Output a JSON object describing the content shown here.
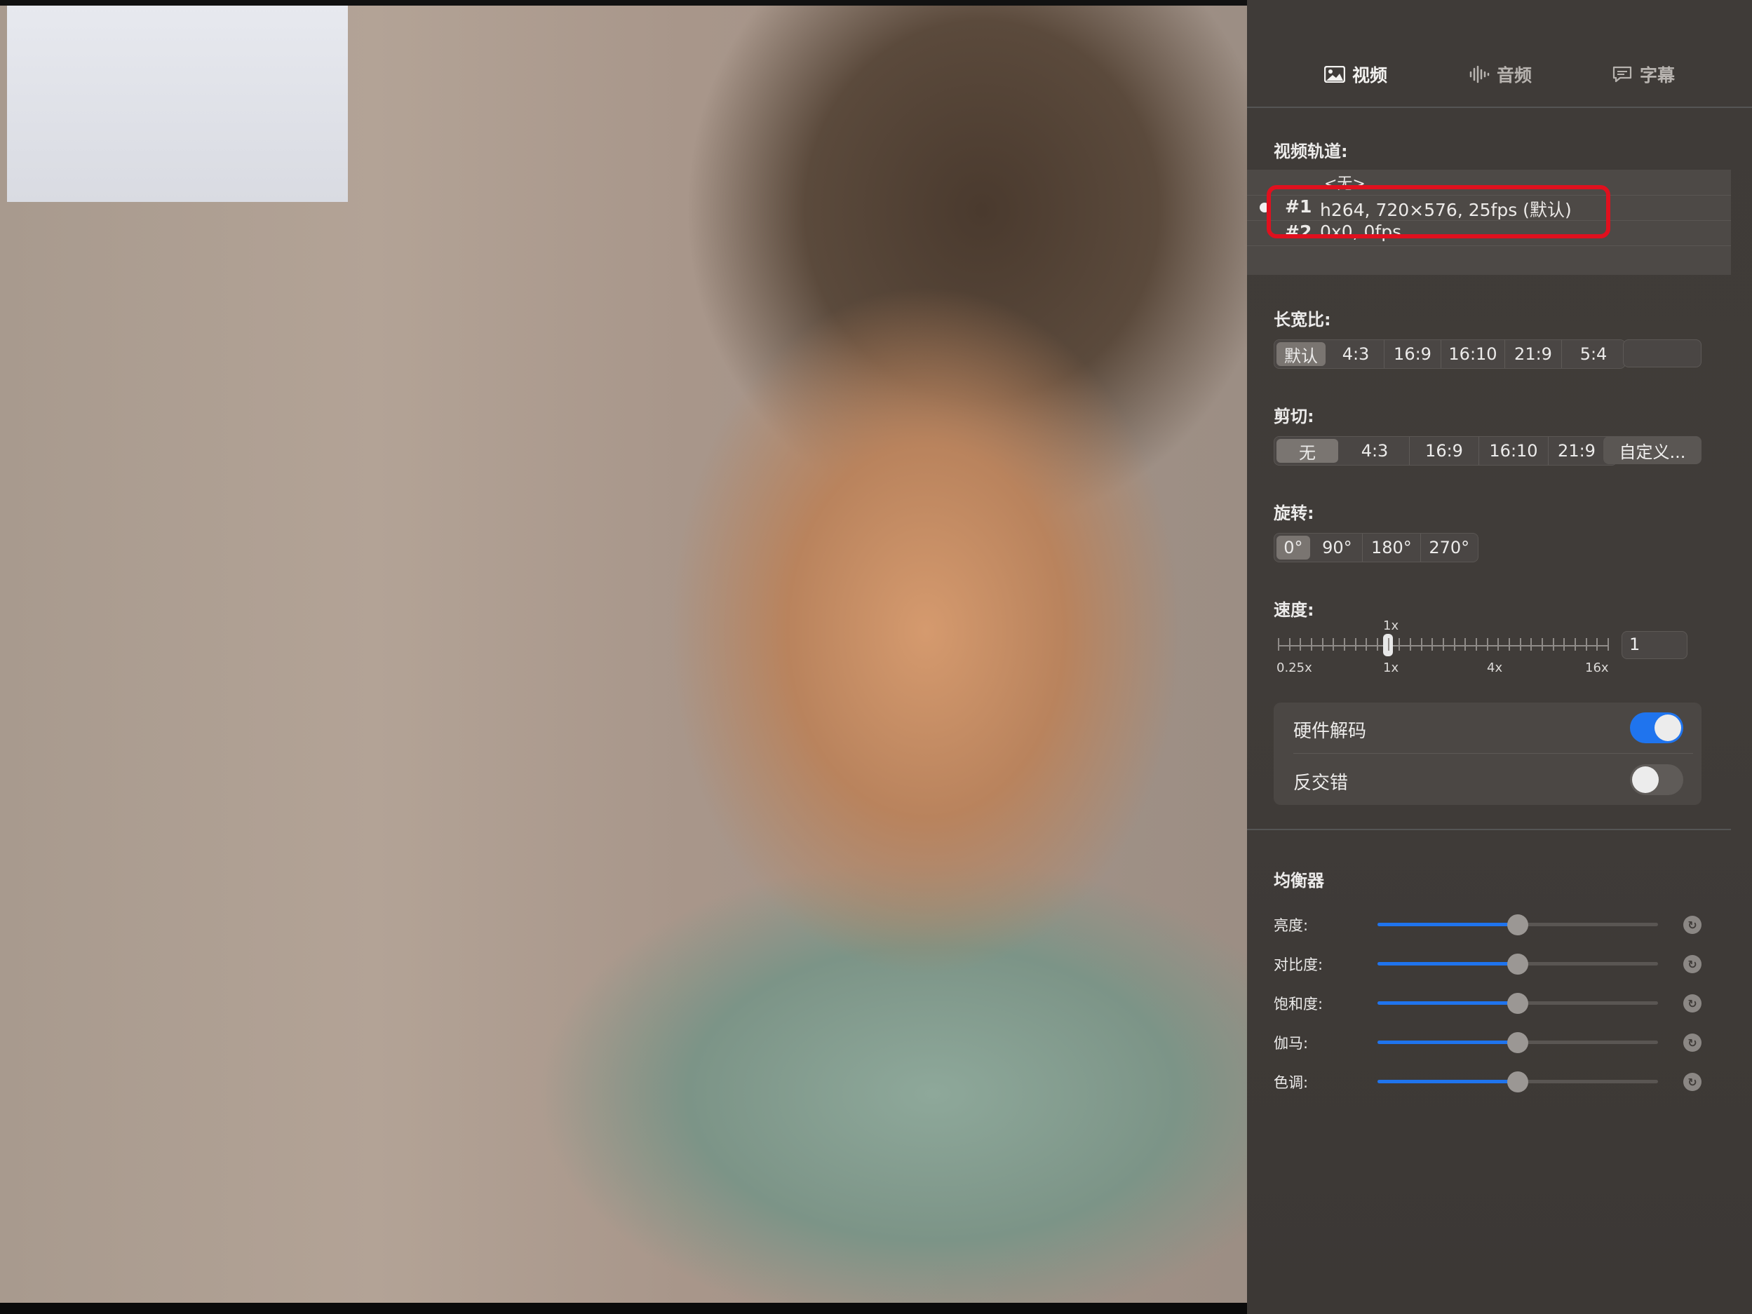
{
  "tabs": [
    {
      "label": "视频",
      "icon": "image-icon",
      "active": true
    },
    {
      "label": "音频",
      "icon": "waveform-icon",
      "active": false
    },
    {
      "label": "字幕",
      "icon": "speech-bubble-icon",
      "active": false
    }
  ],
  "video_tracks": {
    "title": "视频轨道:",
    "rows": [
      {
        "num": "",
        "desc": "<无>"
      },
      {
        "num": "#1",
        "desc": "h264, 720×576, 25fps (默认)",
        "selected": true
      },
      {
        "num": "#2",
        "desc": "0x0, 0fps"
      }
    ]
  },
  "aspect": {
    "title": "长宽比:",
    "options": [
      "默认",
      "4:3",
      "16:9",
      "16:10",
      "21:9",
      "5:4"
    ],
    "selected": "默认",
    "custom_value": ""
  },
  "crop": {
    "title": "剪切:",
    "options": [
      "无",
      "4:3",
      "16:9",
      "16:10",
      "21:9"
    ],
    "selected": "无",
    "custom_button": "自定义..."
  },
  "rotate": {
    "title": "旋转:",
    "options": [
      "0°",
      "90°",
      "180°",
      "270°"
    ],
    "selected": "0°"
  },
  "speed": {
    "title": "速度:",
    "current_label": "1x",
    "tick_labels": [
      "0.25x",
      "1x",
      "4x",
      "16x"
    ],
    "value": "1"
  },
  "toggles": {
    "hw_decode": {
      "label": "硬件解码",
      "on": true
    },
    "deinterlace": {
      "label": "反交错",
      "on": false
    }
  },
  "equalizer": {
    "title": "均衡器",
    "rows": [
      {
        "label": "亮度:",
        "value": 0.5
      },
      {
        "label": "对比度:",
        "value": 0.5
      },
      {
        "label": "饱和度:",
        "value": 0.5
      },
      {
        "label": "伽马:",
        "value": 0.5
      },
      {
        "label": "色调:",
        "value": 0.5
      }
    ]
  },
  "colors": {
    "accent": "#1f74ee",
    "highlight": "#e0101e"
  }
}
